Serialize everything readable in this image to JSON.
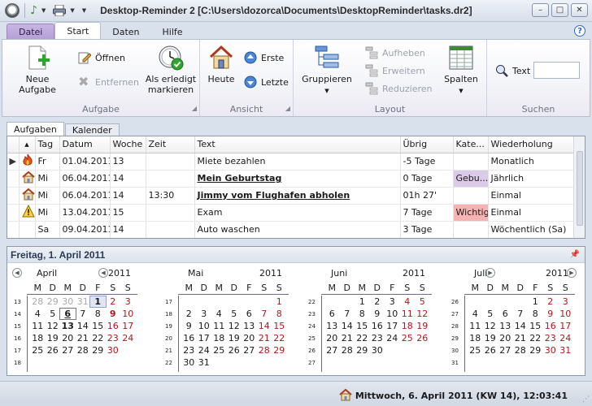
{
  "window": {
    "title": "Desktop-Reminder 2 [C:\\Users\\dozorca\\Documents\\DesktopReminder\\tasks.dr2]",
    "minimize": "–",
    "maximize": "□",
    "close": "✕"
  },
  "ribbon_tabs": [
    "Datei",
    "Start",
    "Daten",
    "Hilfe"
  ],
  "help": "?",
  "groups": {
    "aufgabe": {
      "label": "Aufgabe",
      "new_task": "Neue Aufgabe",
      "open": "Öffnen",
      "remove": "Entfernen",
      "mark_done_1": "Als erledigt",
      "mark_done_2": "markieren"
    },
    "ansicht": {
      "label": "Ansicht",
      "today": "Heute",
      "first": "Erste",
      "last": "Letzte"
    },
    "layout": {
      "label": "Layout",
      "group": "Gruppieren",
      "lift": "Aufheben",
      "expand": "Erweitern",
      "reduce": "Reduzieren",
      "columns": "Spalten"
    },
    "suchen": {
      "label": "Suchen",
      "text_label": "Text",
      "text_value": ""
    }
  },
  "content_tabs": [
    "Aufgaben",
    "Kalender"
  ],
  "tasks": {
    "columns": [
      "",
      "Tag",
      "Datum",
      "Woche",
      "Zeit",
      "Text",
      "Übrig",
      "Kate...",
      "Wiederholung"
    ],
    "rows": [
      {
        "icon": "fire-icon",
        "day": "Fr",
        "date": "01.04.2011",
        "week": "13",
        "time": "",
        "text": "Miete bezahlen",
        "remaining": "-5 Tage",
        "category": "",
        "repeat": "Monatlich",
        "bold": false,
        "cat_color": ""
      },
      {
        "icon": "home-icon",
        "day": "Mi",
        "date": "06.04.2011",
        "week": "14",
        "time": "",
        "text": "Mein Geburtstag",
        "remaining": "0 Tage",
        "category": "Gebu...",
        "repeat": "Jährlich",
        "bold": true,
        "cat_color": "#dccbe8"
      },
      {
        "icon": "home-icon",
        "day": "Mi",
        "date": "06.04.2011",
        "week": "14",
        "time": "13:30",
        "text": "Jimmy vom Flughafen abholen",
        "remaining": "01h 27'",
        "category": "",
        "repeat": "Einmal",
        "bold": true,
        "cat_color": ""
      },
      {
        "icon": "warning-icon",
        "day": "Mi",
        "date": "13.04.2011",
        "week": "15",
        "time": "",
        "text": "Exam",
        "remaining": "7 Tage",
        "category": "Wichtig",
        "repeat": "Einmal",
        "bold": false,
        "cat_color": "#f6b3b3"
      },
      {
        "icon": "",
        "day": "Sa",
        "date": "09.04.2011",
        "week": "14",
        "time": "",
        "text": "Auto waschen",
        "remaining": "3 Tage",
        "category": "",
        "repeat": "Wöchentlich (Sa)",
        "bold": false,
        "cat_color": ""
      }
    ]
  },
  "calendar": {
    "header": "Freitag, 1. April 2011",
    "dow": [
      "M",
      "D",
      "M",
      "D",
      "F",
      "S",
      "S"
    ],
    "months": [
      {
        "name": "April",
        "year": "2011",
        "nav": "prev",
        "weeks": [
          {
            "no": "13",
            "days": [
              [
                "28",
                "o"
              ],
              [
                "29",
                "o"
              ],
              [
                "30",
                "o"
              ],
              [
                "31",
                "o"
              ],
              [
                "1",
                "sel"
              ],
              [
                "2",
                "we"
              ],
              [
                "3",
                "we"
              ]
            ]
          },
          {
            "no": "14",
            "days": [
              [
                "4",
                ""
              ],
              [
                "5",
                ""
              ],
              [
                "6",
                "today"
              ],
              [
                "7",
                ""
              ],
              [
                "8",
                ""
              ],
              [
                "9",
                "webold"
              ],
              [
                "10",
                "we"
              ]
            ]
          },
          {
            "no": "15",
            "days": [
              [
                "11",
                ""
              ],
              [
                "12",
                ""
              ],
              [
                "13",
                "bold"
              ],
              [
                "14",
                ""
              ],
              [
                "15",
                ""
              ],
              [
                "16",
                "we"
              ],
              [
                "17",
                "we"
              ]
            ]
          },
          {
            "no": "16",
            "days": [
              [
                "18",
                ""
              ],
              [
                "19",
                ""
              ],
              [
                "20",
                ""
              ],
              [
                "21",
                ""
              ],
              [
                "22",
                ""
              ],
              [
                "23",
                "we"
              ],
              [
                "24",
                "we"
              ]
            ]
          },
          {
            "no": "17",
            "days": [
              [
                "25",
                ""
              ],
              [
                "26",
                ""
              ],
              [
                "27",
                ""
              ],
              [
                "28",
                ""
              ],
              [
                "29",
                ""
              ],
              [
                "30",
                "we"
              ],
              [
                "",
                ""
              ]
            ]
          },
          {
            "no": "18",
            "days": [
              [
                "",
                ""
              ],
              [
                "",
                ""
              ],
              [
                "",
                ""
              ],
              [
                "",
                ""
              ],
              [
                "",
                ""
              ],
              [
                "",
                ""
              ],
              [
                "",
                ""
              ]
            ]
          }
        ]
      },
      {
        "name": "Mai",
        "year": "2011",
        "nav": "",
        "weeks": [
          {
            "no": "17",
            "days": [
              [
                "",
                ""
              ],
              [
                "",
                ""
              ],
              [
                "",
                ""
              ],
              [
                "",
                ""
              ],
              [
                "",
                ""
              ],
              [
                "",
                ""
              ],
              [
                "1",
                "we"
              ]
            ]
          },
          {
            "no": "18",
            "days": [
              [
                "2",
                ""
              ],
              [
                "3",
                ""
              ],
              [
                "4",
                ""
              ],
              [
                "5",
                ""
              ],
              [
                "6",
                ""
              ],
              [
                "7",
                "we"
              ],
              [
                "8",
                "we"
              ]
            ]
          },
          {
            "no": "19",
            "days": [
              [
                "9",
                ""
              ],
              [
                "10",
                ""
              ],
              [
                "11",
                ""
              ],
              [
                "12",
                ""
              ],
              [
                "13",
                ""
              ],
              [
                "14",
                "we"
              ],
              [
                "15",
                "we"
              ]
            ]
          },
          {
            "no": "20",
            "days": [
              [
                "16",
                ""
              ],
              [
                "17",
                ""
              ],
              [
                "18",
                ""
              ],
              [
                "19",
                ""
              ],
              [
                "20",
                ""
              ],
              [
                "21",
                "we"
              ],
              [
                "22",
                "we"
              ]
            ]
          },
          {
            "no": "21",
            "days": [
              [
                "23",
                ""
              ],
              [
                "24",
                ""
              ],
              [
                "25",
                ""
              ],
              [
                "26",
                ""
              ],
              [
                "27",
                ""
              ],
              [
                "28",
                "we"
              ],
              [
                "29",
                "we"
              ]
            ]
          },
          {
            "no": "22",
            "days": [
              [
                "30",
                ""
              ],
              [
                "31",
                ""
              ],
              [
                "",
                ""
              ],
              [
                "",
                ""
              ],
              [
                "",
                ""
              ],
              [
                "",
                ""
              ],
              [
                "",
                ""
              ]
            ]
          }
        ]
      },
      {
        "name": "Juni",
        "year": "2011",
        "nav": "",
        "weeks": [
          {
            "no": "22",
            "days": [
              [
                "",
                ""
              ],
              [
                "",
                ""
              ],
              [
                "1",
                ""
              ],
              [
                "2",
                ""
              ],
              [
                "3",
                ""
              ],
              [
                "4",
                "we"
              ],
              [
                "5",
                "we"
              ]
            ]
          },
          {
            "no": "23",
            "days": [
              [
                "6",
                ""
              ],
              [
                "7",
                ""
              ],
              [
                "8",
                ""
              ],
              [
                "9",
                ""
              ],
              [
                "10",
                ""
              ],
              [
                "11",
                "we"
              ],
              [
                "12",
                "we"
              ]
            ]
          },
          {
            "no": "24",
            "days": [
              [
                "13",
                ""
              ],
              [
                "14",
                ""
              ],
              [
                "15",
                ""
              ],
              [
                "16",
                ""
              ],
              [
                "17",
                ""
              ],
              [
                "18",
                "we"
              ],
              [
                "19",
                "we"
              ]
            ]
          },
          {
            "no": "25",
            "days": [
              [
                "20",
                ""
              ],
              [
                "21",
                ""
              ],
              [
                "22",
                ""
              ],
              [
                "23",
                ""
              ],
              [
                "24",
                ""
              ],
              [
                "25",
                "we"
              ],
              [
                "26",
                "we"
              ]
            ]
          },
          {
            "no": "26",
            "days": [
              [
                "27",
                ""
              ],
              [
                "28",
                ""
              ],
              [
                "29",
                ""
              ],
              [
                "30",
                ""
              ],
              [
                "",
                ""
              ],
              [
                "",
                ""
              ],
              [
                "",
                ""
              ]
            ]
          },
          {
            "no": "27",
            "days": [
              [
                "",
                ""
              ],
              [
                "",
                ""
              ],
              [
                "",
                ""
              ],
              [
                "",
                ""
              ],
              [
                "",
                ""
              ],
              [
                "",
                ""
              ],
              [
                "",
                ""
              ]
            ]
          }
        ]
      },
      {
        "name": "Juli",
        "year": "2011",
        "nav": "next",
        "weeks": [
          {
            "no": "26",
            "days": [
              [
                "",
                ""
              ],
              [
                "",
                ""
              ],
              [
                "",
                ""
              ],
              [
                "",
                ""
              ],
              [
                "1",
                ""
              ],
              [
                "2",
                "we"
              ],
              [
                "3",
                "we"
              ]
            ]
          },
          {
            "no": "27",
            "days": [
              [
                "4",
                ""
              ],
              [
                "5",
                ""
              ],
              [
                "6",
                ""
              ],
              [
                "7",
                ""
              ],
              [
                "8",
                ""
              ],
              [
                "9",
                "we"
              ],
              [
                "10",
                "we"
              ]
            ]
          },
          {
            "no": "28",
            "days": [
              [
                "11",
                ""
              ],
              [
                "12",
                ""
              ],
              [
                "13",
                ""
              ],
              [
                "14",
                ""
              ],
              [
                "15",
                ""
              ],
              [
                "16",
                "we"
              ],
              [
                "17",
                "we"
              ]
            ]
          },
          {
            "no": "29",
            "days": [
              [
                "18",
                ""
              ],
              [
                "19",
                ""
              ],
              [
                "20",
                ""
              ],
              [
                "21",
                ""
              ],
              [
                "22",
                ""
              ],
              [
                "23",
                "we"
              ],
              [
                "24",
                "we"
              ]
            ]
          },
          {
            "no": "30",
            "days": [
              [
                "25",
                ""
              ],
              [
                "26",
                ""
              ],
              [
                "27",
                ""
              ],
              [
                "28",
                ""
              ],
              [
                "29",
                ""
              ],
              [
                "30",
                "we"
              ],
              [
                "31",
                "we"
              ]
            ]
          },
          {
            "no": "31",
            "days": [
              [
                "",
                ""
              ],
              [
                "",
                ""
              ],
              [
                "",
                ""
              ],
              [
                "",
                ""
              ],
              [
                "",
                ""
              ],
              [
                "",
                ""
              ],
              [
                "",
                ""
              ]
            ]
          }
        ]
      }
    ]
  },
  "status": {
    "text": "Mittwoch, 6. April 2011 (KW 14), 12:03:41"
  }
}
